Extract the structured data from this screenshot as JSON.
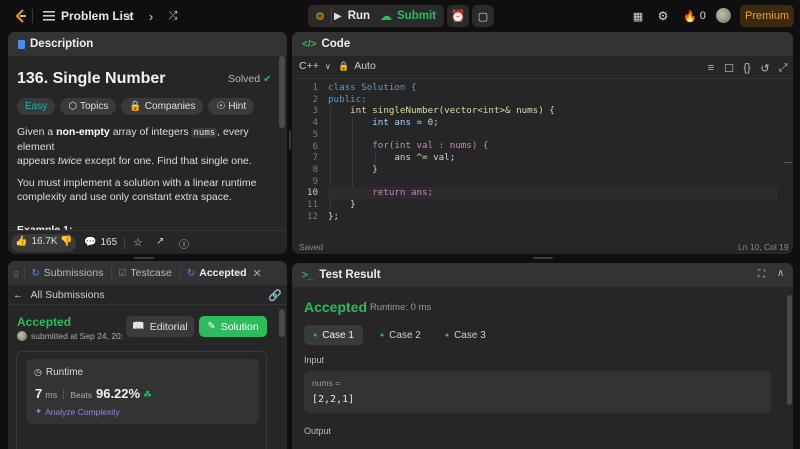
{
  "topbar": {
    "problem_list": "Problem List",
    "run": "Run",
    "submit": "Submit",
    "streak": "0",
    "premium": "Premium"
  },
  "description": {
    "tab": "Description",
    "title": "136. Single Number",
    "solved": "Solved",
    "tags": {
      "difficulty": "Easy",
      "topics": "Topics",
      "companies": "Companies",
      "hint": "Hint"
    },
    "p1_a": "Given a ",
    "p1_b": "non-empty",
    "p1_c": " array of integers ",
    "p1_d": "nums",
    "p1_e": ", every element",
    "p1_f": "appears ",
    "p1_g": "twice",
    "p1_h": " except for one. Find that single one.",
    "p2_a": "You must implement a solution with a linear runtime",
    "p2_b": "complexity and use only constant extra space.",
    "example_heading": "Example 1:",
    "likes": "16.7K",
    "comments": "165"
  },
  "code": {
    "tab": "Code",
    "language": "C++",
    "mode": "Auto",
    "saved": "Saved",
    "position": "Ln 10, Col 19",
    "line_numbers": [
      "1",
      "2",
      "3",
      "4",
      "5",
      "6",
      "7",
      "8",
      "9",
      "10",
      "11",
      "12"
    ],
    "lines": [
      "class Solution {",
      "public:",
      "    int singleNumber(vector<int>& nums) {",
      "        int ans = 0;",
      "",
      "        for(int val : nums) {",
      "            ans ^= val;",
      "        }",
      "",
      "        return ans;",
      "    }",
      "};"
    ]
  },
  "submissions": {
    "tab_submissions": "Submissions",
    "tab_testcase": "Testcase",
    "tab_accepted": "Accepted",
    "all_submissions": "All Submissions",
    "status": "Accepted",
    "submitted": "submitted at Sep 24, 20:",
    "editorial": "Editorial",
    "solution": "Solution",
    "runtime_label": "Runtime",
    "runtime_value": "7",
    "runtime_unit": "ms",
    "beats_label": "Beats",
    "beats_value": "96.22%",
    "analyze": "Analyze Complexity"
  },
  "test_result": {
    "tab": "Test Result",
    "status": "Accepted",
    "runtime": "Runtime: 0 ms",
    "cases": [
      "Case 1",
      "Case 2",
      "Case 3"
    ],
    "input_label": "Input",
    "var_name": "nums =",
    "var_value": "[2,2,1]",
    "output_label": "Output"
  }
}
